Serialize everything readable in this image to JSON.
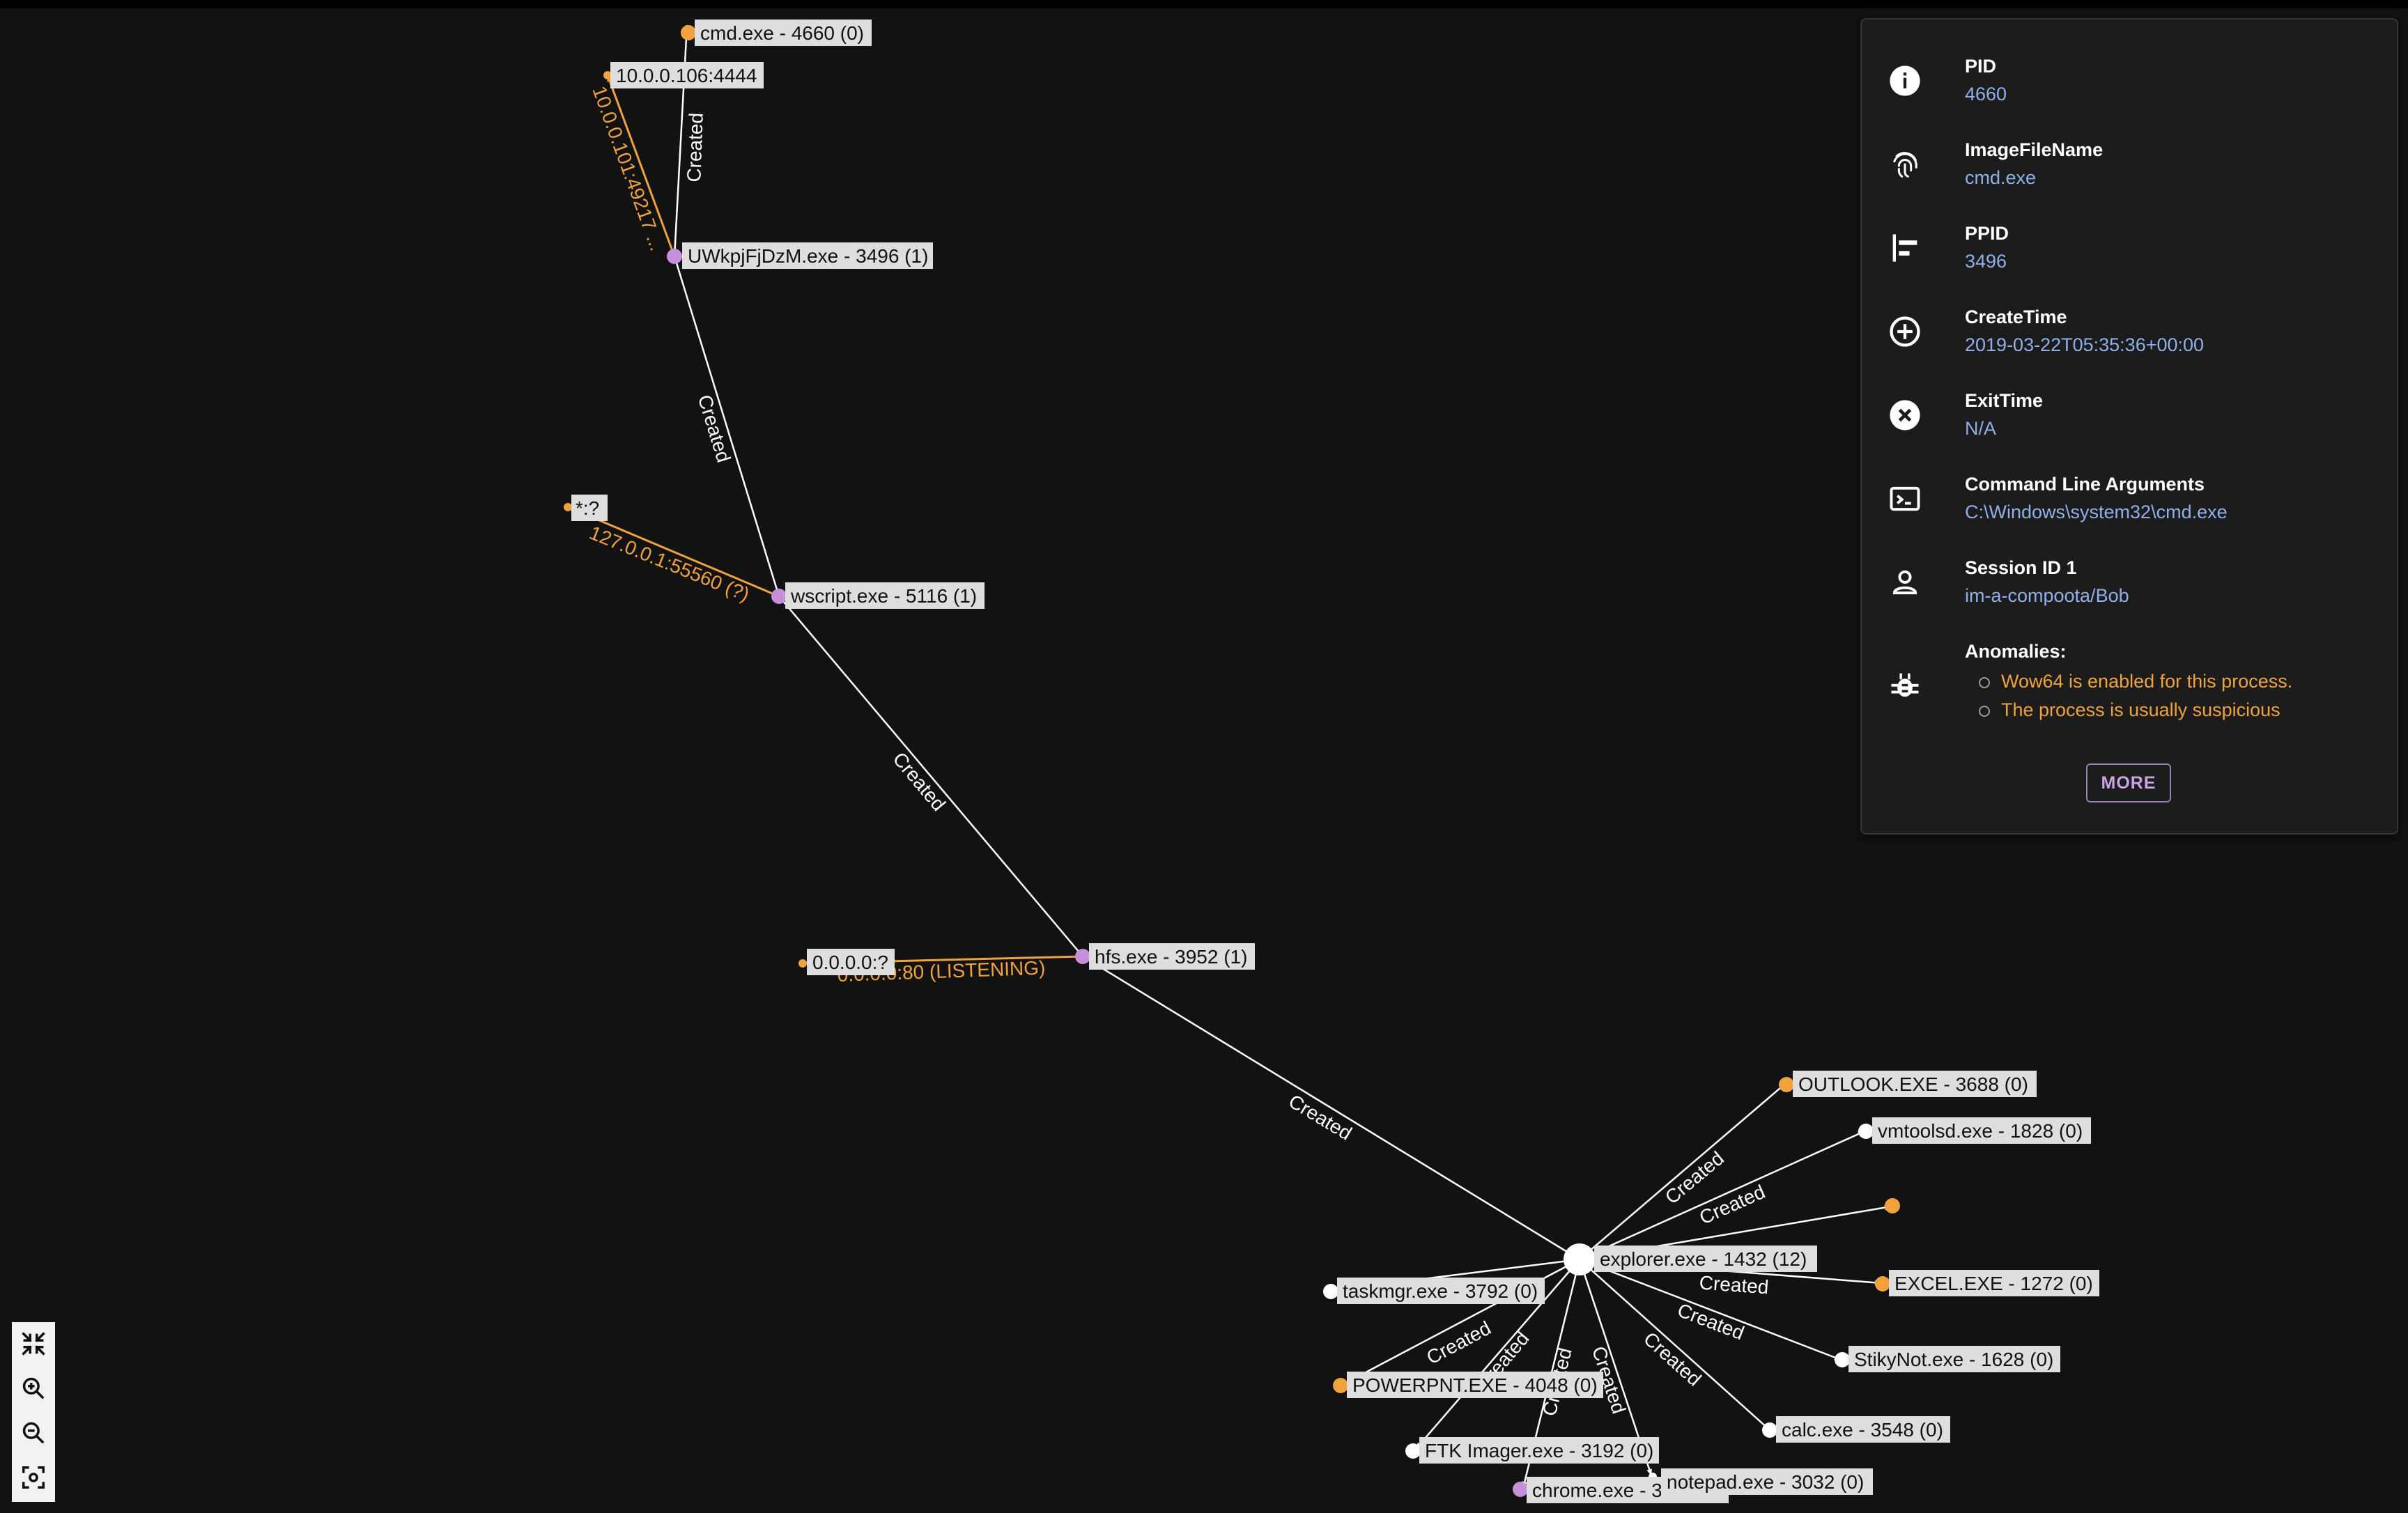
{
  "colors": {
    "background": "#121212",
    "edge_created": "#ffffff",
    "edge_network": "#f0a23d",
    "node_suspicious": "#f0a23d",
    "node_process": "#c58fd9",
    "node_normal": "#ffffff",
    "value_text": "#8fb0e8",
    "anomaly_text": "#f0a23d",
    "button_border": "#9a7fb5"
  },
  "graph": {
    "edge_label": "Created",
    "nodes": [
      {
        "id": "cmd",
        "label": "cmd.exe - 4660 (0)",
        "kind": "suspicious"
      },
      {
        "id": "net106",
        "label": "10.0.0.106:4444",
        "kind": "network"
      },
      {
        "id": "uwk",
        "label": "UWkpjFjDzM.exe - 3496 (1)",
        "kind": "process"
      },
      {
        "id": "star",
        "label": "*:?",
        "kind": "network"
      },
      {
        "id": "wscript",
        "label": "wscript.exe - 5116 (1)",
        "kind": "process"
      },
      {
        "id": "zero",
        "label": "0.0.0.0:?",
        "kind": "network"
      },
      {
        "id": "hfs",
        "label": "hfs.exe - 3952 (1)",
        "kind": "process"
      },
      {
        "id": "explorer",
        "label": "explorer.exe - 1432 (12)",
        "kind": "normal"
      },
      {
        "id": "outlook",
        "label": "OUTLOOK.EXE - 3688 (0)",
        "kind": "suspicious"
      },
      {
        "id": "vmtools",
        "label": "vmtoolsd.exe - 1828 (0)",
        "kind": "normal"
      },
      {
        "id": "unnamed",
        "label": "",
        "kind": "suspicious"
      },
      {
        "id": "excel",
        "label": "EXCEL.EXE - 1272 (0)",
        "kind": "suspicious"
      },
      {
        "id": "stiky",
        "label": "StikyNot.exe - 1628 (0)",
        "kind": "normal"
      },
      {
        "id": "calc",
        "label": "calc.exe - 3548 (0)",
        "kind": "normal"
      },
      {
        "id": "notepad",
        "label": "notepad.exe - 3032 (0)",
        "kind": "normal"
      },
      {
        "id": "chrome",
        "label": "chrome.exe - 3",
        "kind": "process"
      },
      {
        "id": "ftk",
        "label": "FTK Imager.exe - 3192 (0)",
        "kind": "normal"
      },
      {
        "id": "ppt",
        "label": "POWERPNT.EXE - 4048 (0)",
        "kind": "suspicious"
      },
      {
        "id": "taskmgr",
        "label": "taskmgr.exe - 3792 (0)",
        "kind": "normal"
      }
    ],
    "network_labels": {
      "uwk_conn": "10.0.0.101:49217 ...",
      "wscript_conn": "127.0.0.1:55560 (?)",
      "hfs_conn": "0.0.0.0:80 (LISTENING)"
    }
  },
  "details": {
    "rows": [
      {
        "key": "PID",
        "value": "4660",
        "icon": "info-icon"
      },
      {
        "key": "ImageFileName",
        "value": "cmd.exe",
        "icon": "fingerprint-icon"
      },
      {
        "key": "PPID",
        "value": "3496",
        "icon": "align-left-icon"
      },
      {
        "key": "CreateTime",
        "value": "2019-03-22T05:35:36+00:00",
        "icon": "add-circle-icon"
      },
      {
        "key": "ExitTime",
        "value": "N/A",
        "icon": "cancel-circle-icon"
      },
      {
        "key": "Command Line Arguments",
        "value": "C:\\Windows\\system32\\cmd.exe",
        "icon": "terminal-icon"
      },
      {
        "key": "Session ID 1",
        "value": "im-a-compoota/Bob",
        "icon": "person-icon"
      }
    ],
    "anomalies_label": "Anomalies:",
    "anomalies_icon": "bug-icon",
    "anomalies": [
      "Wow64 is enabled for this process.",
      "The process is usually suspicious"
    ],
    "more_button": "MORE"
  },
  "zoom_controls": [
    {
      "name": "fit-graph-button",
      "icon": "collapse-arrows-icon"
    },
    {
      "name": "zoom-in-button",
      "icon": "zoom-in-icon"
    },
    {
      "name": "zoom-out-button",
      "icon": "zoom-out-icon"
    },
    {
      "name": "center-focus-button",
      "icon": "center-focus-icon"
    }
  ]
}
